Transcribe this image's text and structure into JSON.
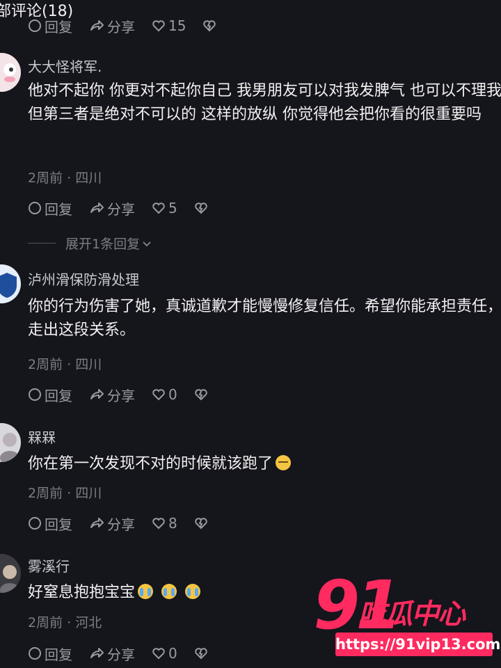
{
  "header": {
    "title": "部评论(18)"
  },
  "top_actions": {
    "reply": "回复",
    "share": "分享",
    "likes": "15"
  },
  "comments": [
    {
      "username": "大大怪将军.",
      "text": "他对不起你 你更对不起你自己 我男朋友可以对我发脾气 也可以不理我 但第三者是绝对不可以的 这样的放纵 你觉得他会把你看的很重要吗",
      "time": "2周前",
      "location": "四川",
      "reply": "回复",
      "share": "分享",
      "likes": "5",
      "expand": "展开1条回复"
    },
    {
      "username": "泸州滑保防滑处理",
      "text": "你的行为伤害了她，真诚道歉才能慢慢修复信任。希望你能承担责任，走出这段关系。",
      "time": "2周前",
      "location": "四川",
      "reply": "回复",
      "share": "分享",
      "likes": "0"
    },
    {
      "username": "槑槑",
      "text": "你在第一次发现不对的时候就该跑了",
      "emoji": "sleepy-face-emoji",
      "time": "2周前",
      "location": "四川",
      "reply": "回复",
      "share": "分享",
      "likes": "8"
    },
    {
      "username": "雾溪行",
      "text": "好窒息抱抱宝宝",
      "emoji": "crying-face-emoji",
      "time": "2周前",
      "location": "河北",
      "reply": "回复",
      "share": "分享",
      "likes": "0"
    }
  ],
  "watermark": {
    "number": "91",
    "name": "吃瓜中心",
    "url": "https://91vip13.com"
  },
  "colors": {
    "background": "#15151c",
    "accent": "#ff2a5f",
    "muted": "#7d7d87"
  }
}
